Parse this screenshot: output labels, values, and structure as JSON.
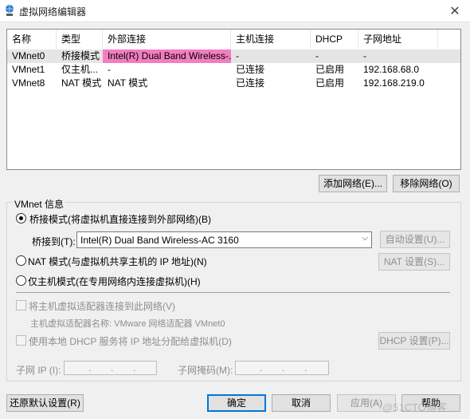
{
  "window": {
    "title": "虚拟网络编辑器",
    "close_glyph": "✕"
  },
  "table": {
    "headers": [
      "名称",
      "类型",
      "外部连接",
      "主机连接",
      "DHCP",
      "子网地址"
    ],
    "rows": [
      [
        "VMnet0",
        "桥接模式",
        "Intel(R) Dual Band Wireless-...",
        "-",
        "-",
        "-"
      ],
      [
        "VMnet1",
        "仅主机...",
        "-",
        "已连接",
        "已启用",
        "192.168.68.0"
      ],
      [
        "VMnet8",
        "NAT 模式",
        "NAT 模式",
        "已连接",
        "已启用",
        "192.168.219.0"
      ]
    ]
  },
  "buttons": {
    "add_network": "添加网络(E)...",
    "remove_network": "移除网络(O)",
    "auto_settings": "自动设置(U)...",
    "nat_settings": "NAT 设置(S)...",
    "dhcp_settings": "DHCP 设置(P)...",
    "restore_defaults": "还原默认设置(R)",
    "ok": "确定",
    "cancel": "取消",
    "apply": "应用(A)",
    "help": "帮助"
  },
  "vmnet_info": {
    "group_title": "VMnet 信息",
    "bridged_radio": "桥接模式(将虚拟机直接连接到外部网络)(B)",
    "bridged_to_label": "桥接到(T):",
    "bridged_to_value": "Intel(R) Dual Band Wireless-AC 3160",
    "nat_radio": "NAT 模式(与虚拟机共享主机的 IP 地址)(N)",
    "hostonly_radio": "仅主机模式(在专用网络内连接虚拟机)(H)",
    "connect_adapter_check": "将主机虚拟适配器连接到此网络(V)",
    "adapter_name_label": "主机虚拟适配器名称: VMware 网络适配器 VMnet0",
    "use_dhcp_check": "使用本地 DHCP 服务将 IP 地址分配给虚拟机(D)",
    "subnet_ip_label": "子网 IP (I):",
    "subnet_mask_label": "子网掩码(M):",
    "ip_dot": "."
  },
  "watermark": "@51CTO博客",
  "colors": {
    "selected_cell": "#f27ec0",
    "focus_border": "#0078d7"
  }
}
